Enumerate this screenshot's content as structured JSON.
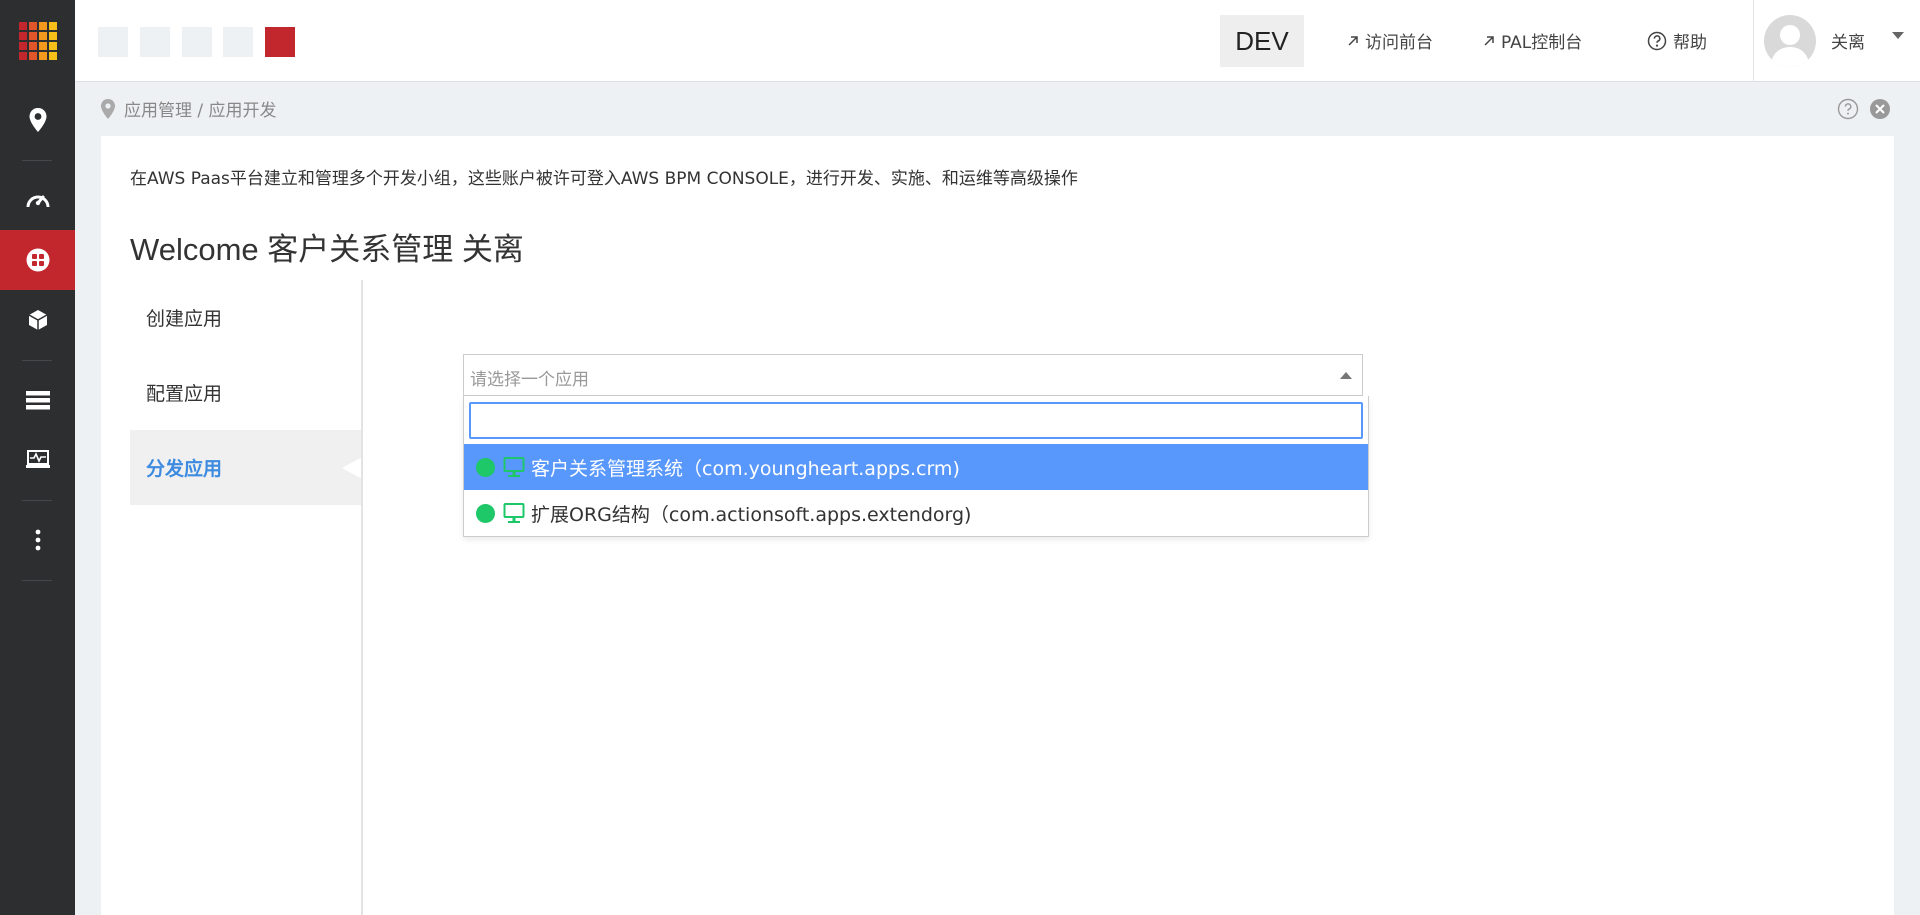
{
  "topbar": {
    "env": "DEV",
    "links": [
      {
        "label": "访问前台"
      },
      {
        "label": "PAL控制台"
      },
      {
        "label": "帮助"
      }
    ],
    "user_name": "关离"
  },
  "breadcrumb": "应用管理 / 应用开发",
  "intro_text": "在AWS Paas平台建立和管理多个开发小组，这些账户被许可登入AWS BPM CONSOLE，进行开发、实施、和运维等高级操作",
  "welcome_text": "Welcome 客户关系管理 关离",
  "steps": [
    {
      "label": "创建应用"
    },
    {
      "label": "配置应用"
    },
    {
      "label": "分发应用"
    }
  ],
  "select": {
    "placeholder": "请选择一个应用",
    "search_value": "",
    "options": [
      {
        "label": "客户关系管理系统（com.youngheart.apps.crm)"
      },
      {
        "label": "扩展ORG结构（com.actionsoft.apps.extendorg)"
      }
    ]
  },
  "colors": {
    "rail_bg": "#2c2e30",
    "accent_red": "#c2272d",
    "highlight_blue": "#5897fb",
    "active_step_text": "#3d8be0",
    "status_green": "#1ec768"
  },
  "icons": {
    "rail": [
      "location-pin-icon",
      "speedometer-icon",
      "apps-grid-icon",
      "cube-icon",
      "list-icon",
      "monitor-pulse-icon",
      "more-vertical-icon"
    ]
  }
}
